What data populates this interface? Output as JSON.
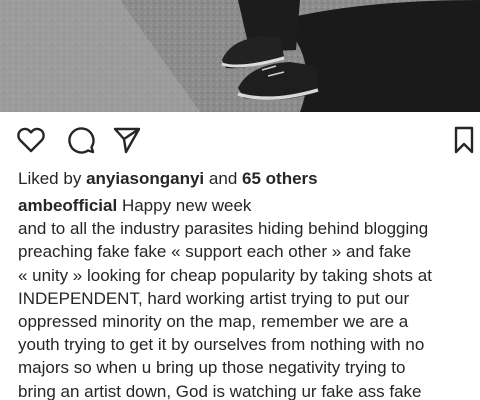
{
  "post": {
    "image_alt_icon": "photo-of-person-in-sneakers",
    "actions": {
      "like_icon": "heart-outline-icon",
      "comment_icon": "comment-bubble-icon",
      "share_icon": "paper-plane-icon",
      "save_icon": "bookmark-outline-icon"
    },
    "likes": {
      "prefix": "Liked by",
      "user": "anyiasonganyi",
      "connector": "and",
      "others": "65 others"
    },
    "caption": {
      "username": "ambeofficial",
      "first_line_text": "Happy new week",
      "lines": [
        "and to all the industry parasites hiding behind blogging",
        "preaching fake fake « support each other » and fake",
        "« unity » looking for cheap popularity by taking shots at",
        "INDEPENDENT, hard working artist trying to put our",
        "oppressed minority on the map, remember we are a",
        "youth trying to get it by ourselves from nothing with no",
        "majors so when u bring up those negativity trying to",
        "bring an artist down, God is watching ur fake ass fake"
      ]
    }
  },
  "colors": {
    "text": "#262626",
    "background": "#ffffff"
  }
}
